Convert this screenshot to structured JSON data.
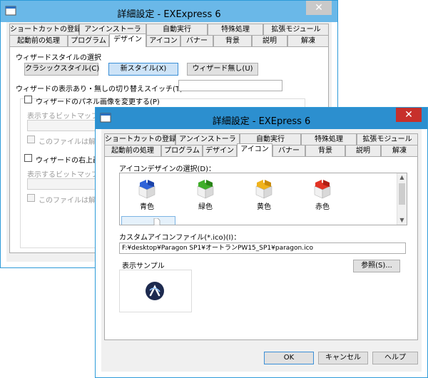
{
  "back_window": {
    "title": "詳細設定 - EXExpress 6",
    "tabs_row1": [
      "ショートカットの登録",
      "アンインストーラ",
      "自動実行",
      "特殊処理",
      "拡張モジュール"
    ],
    "tabs_row2": [
      "起動前の処理",
      "プログラム",
      "デザイン",
      "アイコン",
      "バナー",
      "背景",
      "説明",
      "解凍"
    ],
    "active_tab": "デザイン",
    "wizard_style_label": "ウィザードスタイルの選択",
    "style_buttons": [
      "クラシックスタイル(C)",
      "新スタイル(X)",
      "ウィザード無し(U)"
    ],
    "toggle_switch_label": "ウィザードの表示あり・無しの切り替えスイッチ(T)：",
    "panel_image_check": "ウィザードのパネル画像を変更する(P)",
    "bitmap_label1": "表示するビットマップファ",
    "extract_label1": "このファイルは解凍し",
    "top_right_check": "ウィザードの右上画像",
    "bitmap_label2": "表示するビットマップファ",
    "extract_label2": "このファイルは解凍し"
  },
  "front_window": {
    "title": "詳細設定 - EXEpress 6",
    "tabs_row1": [
      "ショートカットの登録",
      "アンインストーラ",
      "自動実行",
      "特殊処理",
      "拡張モジュール"
    ],
    "tabs_row2": [
      "起動前の処理",
      "プログラム",
      "デザイン",
      "アイコン",
      "バナー",
      "背景",
      "説明",
      "解凍"
    ],
    "active_tab": "アイコン",
    "icon_design_label": "アイコンデザインの選択(D)：",
    "icons": [
      {
        "label": "青色",
        "color": "#2f63d8"
      },
      {
        "label": "緑色",
        "color": "#3fae2a"
      },
      {
        "label": "黄色",
        "color": "#f0b31c"
      },
      {
        "label": "赤色",
        "color": "#e23324"
      }
    ],
    "custom_icon_label": "カスタムアイコンファイル(*.ico)(I)：",
    "custom_icon_path": "F:¥desktop¥Paragon SP1¥オートランPW15_SP1¥paragon.ico",
    "browse_button": "参照(S)...",
    "preview_label": "表示サンプル",
    "ok_button": "OK",
    "cancel_button": "キャンセル",
    "help_button": "ヘルプ"
  }
}
